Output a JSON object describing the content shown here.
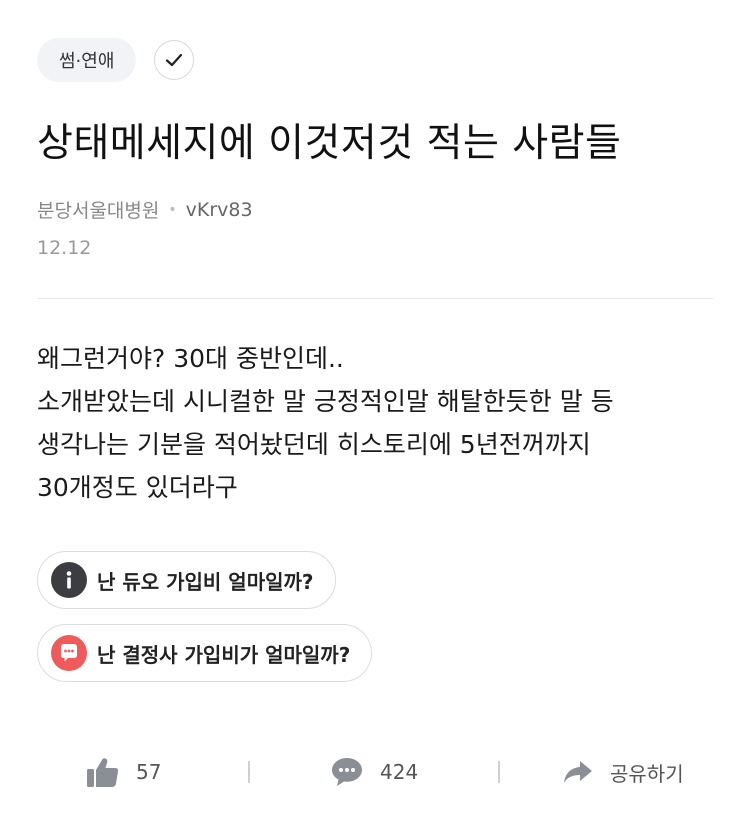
{
  "category": {
    "label": "썸·연애"
  },
  "title": "상태메세지에 이것저것 적는 사람들",
  "meta": {
    "board": "분당서울대병원",
    "user": "vKrv83",
    "date": "12.12"
  },
  "body_lines": [
    "왜그런거야? 30대 중반인데..",
    "소개받았는데 시니컬한 말 긍정적인말 해탈한듯한 말 등",
    "생각나는 기분을 적어놨던데 히스토리에 5년전꺼까지",
    "30개정도 있더라구"
  ],
  "related_posts": [
    {
      "label": "난 듀오 가입비 얼마일까?",
      "icon": "info-icon",
      "icon_color": "#3c3d42"
    },
    {
      "label": "난 결정사 가입비가 얼마일까?",
      "icon": "chat-bubble-icon",
      "icon_color": "#f05a5a"
    }
  ],
  "actions": {
    "likes": "57",
    "comments": "424",
    "share_label": "공유하기"
  }
}
